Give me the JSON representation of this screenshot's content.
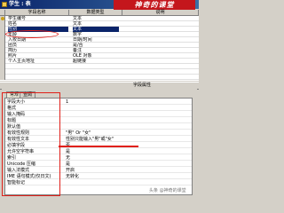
{
  "window": {
    "title": "学生 : 表"
  },
  "brand": {
    "text": "神奇的课堂"
  },
  "table": {
    "headers": [
      "字段名称",
      "数据类型",
      "说明"
    ],
    "rows": [
      {
        "name": "学生编号",
        "type": "文本",
        "desc": ""
      },
      {
        "name": "姓名",
        "type": "文本",
        "desc": ""
      },
      {
        "name": "性别",
        "type": "文本",
        "desc": ""
      },
      {
        "name": "年龄",
        "type": "数字",
        "desc": ""
      },
      {
        "name": "入校日期",
        "type": "日期/时间",
        "desc": ""
      },
      {
        "name": "团员",
        "type": "是/否",
        "desc": ""
      },
      {
        "name": "简历",
        "type": "备注",
        "desc": ""
      },
      {
        "name": "照片",
        "type": "OLE 对象",
        "desc": ""
      },
      {
        "name": "个人主页地址",
        "type": "超链接",
        "desc": ""
      }
    ]
  },
  "properties": {
    "header": "字段属性",
    "tabs": [
      "常规",
      "查阅"
    ],
    "rows": [
      {
        "label": "字段大小",
        "value": "1"
      },
      {
        "label": "格式",
        "value": ""
      },
      {
        "label": "输入掩码",
        "value": ""
      },
      {
        "label": "标题",
        "value": ""
      },
      {
        "label": "默认值",
        "value": ""
      },
      {
        "label": "有效性规则",
        "value": "\"男\" Or \"女\""
      },
      {
        "label": "有效性文本",
        "value": "性别只能输入\"男\"或\"女\""
      },
      {
        "label": "必填字段",
        "value": "否"
      },
      {
        "label": "允许空字符串",
        "value": "是"
      },
      {
        "label": "索引",
        "value": "无"
      },
      {
        "label": "Unicode 压缩",
        "value": "是"
      },
      {
        "label": "输入法模式",
        "value": "开启"
      },
      {
        "label": "IME 语句模式(仅日文)",
        "value": "无转化"
      },
      {
        "label": "智能标记",
        "value": ""
      }
    ]
  },
  "watermark": {
    "text": "头条 @神奇的课堂"
  }
}
